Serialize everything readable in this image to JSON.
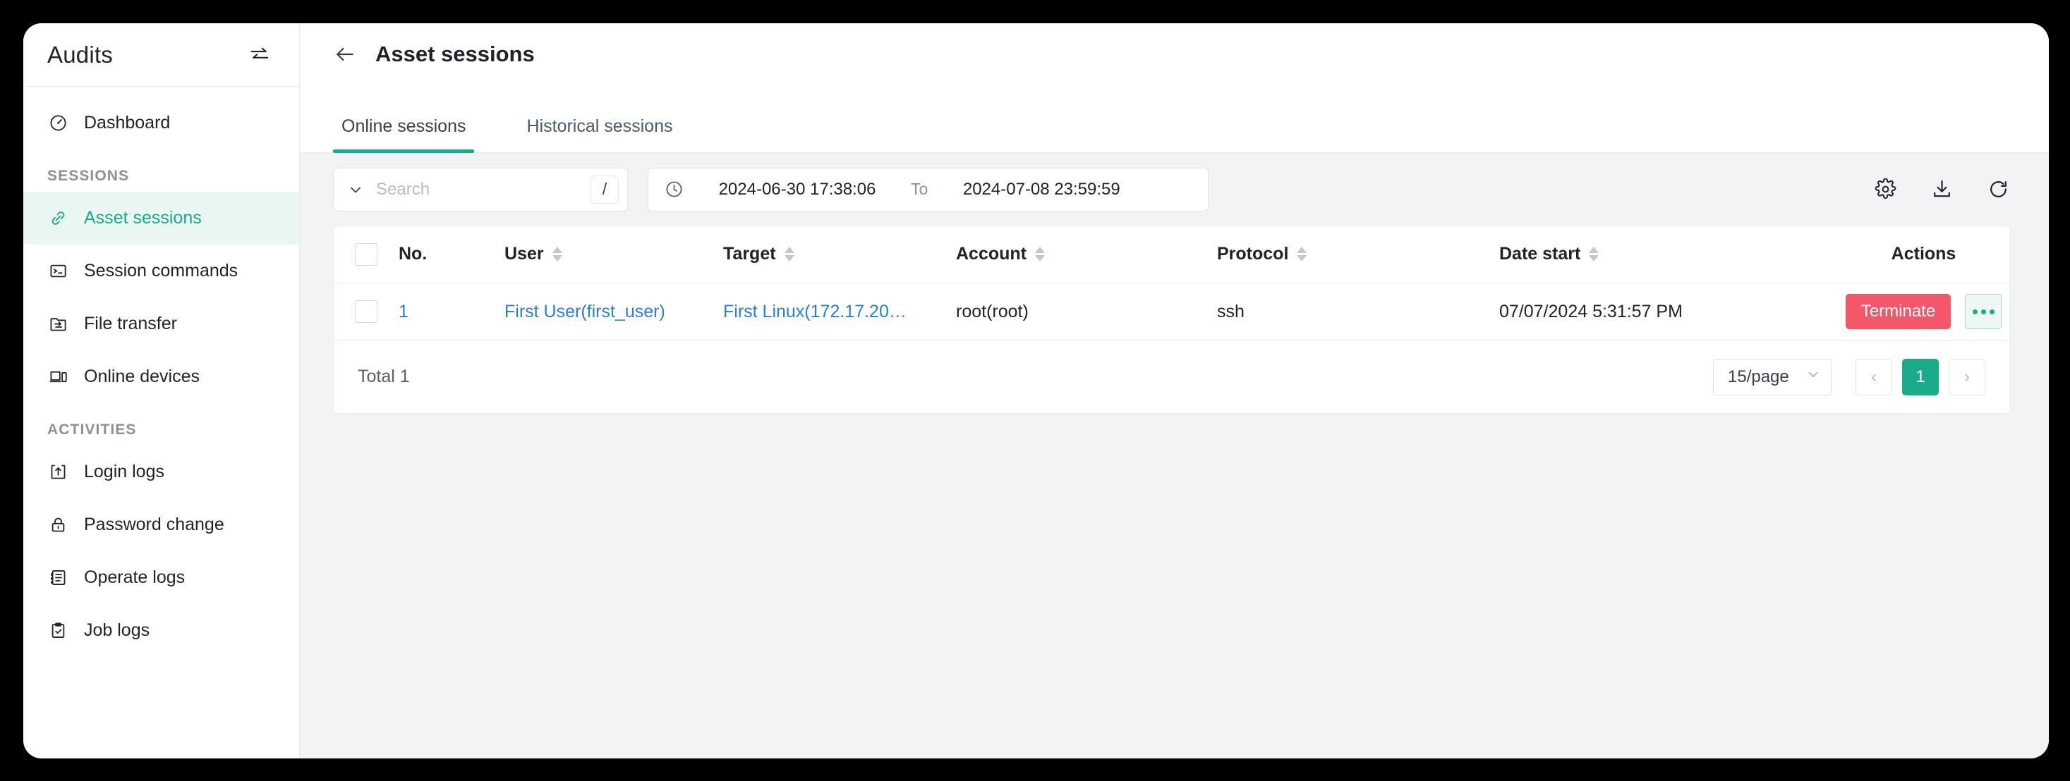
{
  "sidebar": {
    "title": "Audits",
    "collapse_icon": "collapse-toggle-icon",
    "items": [
      {
        "label": "Dashboard",
        "icon": "dashboard-icon",
        "type": "item",
        "active": false
      },
      {
        "label": "SESSIONS",
        "type": "section"
      },
      {
        "label": "Asset sessions",
        "icon": "link-icon",
        "type": "item",
        "active": true
      },
      {
        "label": "Session commands",
        "icon": "terminal-icon",
        "type": "item",
        "active": false
      },
      {
        "label": "File transfer",
        "icon": "folder-transfer-icon",
        "type": "item",
        "active": false
      },
      {
        "label": "Online devices",
        "icon": "device-icon",
        "type": "item",
        "active": false
      },
      {
        "label": "ACTIVITIES",
        "type": "section"
      },
      {
        "label": "Login logs",
        "icon": "login-icon",
        "type": "item",
        "active": false
      },
      {
        "label": "Password change",
        "icon": "lock-icon",
        "type": "item",
        "active": false
      },
      {
        "label": "Operate logs",
        "icon": "list-doc-icon",
        "type": "item",
        "active": false
      },
      {
        "label": "Job logs",
        "icon": "clipboard-check-icon",
        "type": "item",
        "active": false
      }
    ]
  },
  "header": {
    "back_icon": "back-arrow-icon",
    "title": "Asset sessions"
  },
  "tabs": [
    {
      "label": "Online sessions",
      "active": true
    },
    {
      "label": "Historical sessions",
      "active": false
    }
  ],
  "filters": {
    "search": {
      "value": "",
      "placeholder": "Search",
      "shortcut": "/",
      "chevron_icon": "chevron-down-icon"
    },
    "date_range": {
      "clock_icon": "clock-icon",
      "start": "2024-06-30 17:38:06",
      "separator": "To",
      "end": "2024-07-08 23:59:59"
    },
    "toolbar": [
      {
        "icon": "gear-icon",
        "name": "column-settings"
      },
      {
        "icon": "download-icon",
        "name": "export"
      },
      {
        "icon": "refresh-icon",
        "name": "refresh"
      }
    ]
  },
  "table": {
    "columns": [
      {
        "key": "check",
        "label": "",
        "sortable": false
      },
      {
        "key": "no",
        "label": "No.",
        "sortable": false
      },
      {
        "key": "user",
        "label": "User",
        "sortable": true
      },
      {
        "key": "target",
        "label": "Target",
        "sortable": true
      },
      {
        "key": "account",
        "label": "Account",
        "sortable": true
      },
      {
        "key": "protocol",
        "label": "Protocol",
        "sortable": true
      },
      {
        "key": "date",
        "label": "Date start",
        "sortable": true
      },
      {
        "key": "actions",
        "label": "Actions",
        "sortable": false
      }
    ],
    "rows": [
      {
        "no": "1",
        "user": "First User(first_user)",
        "target": "First Linux(172.17.20…",
        "account": "root(root)",
        "protocol": "ssh",
        "date": "07/07/2024 5:31:57 PM",
        "actions": {
          "terminate_label": "Terminate",
          "more_label": "…"
        }
      }
    ]
  },
  "footer": {
    "total": "Total 1",
    "page_size": "15/page",
    "prev": "‹",
    "current_page": "1",
    "next": "›"
  },
  "colors": {
    "accent": "#1aab8b",
    "danger": "#f2576a",
    "link": "#2a7fd4",
    "active_bg": "#e9f6f2",
    "page_bg": "#f2f3f5"
  }
}
